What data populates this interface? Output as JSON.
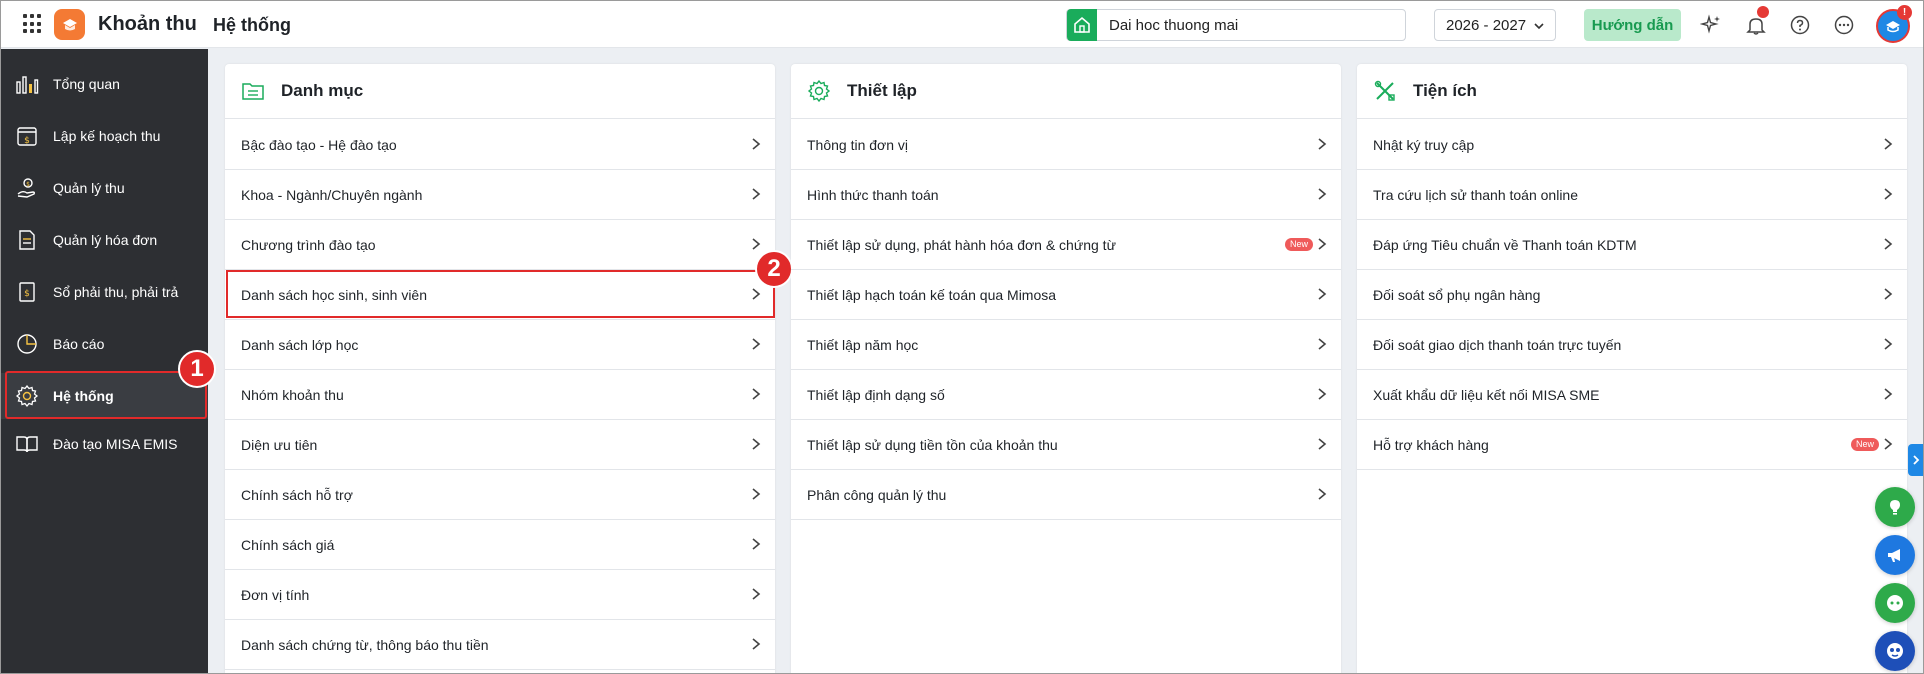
{
  "app": {
    "title": "Khoản thu",
    "page_title": "Hệ thống"
  },
  "topbar": {
    "unit_name": "Dai hoc thuong mai",
    "school_year": "2026 - 2027",
    "guide_label": "Hướng dẫn",
    "icons": [
      "apps-grid-icon",
      "sparkle-ai-icon",
      "bell-icon",
      "help-icon",
      "more-icon"
    ],
    "avatar_badge": "!"
  },
  "sidebar": {
    "items": [
      {
        "label": "Tổng quan",
        "icon": "bar-chart-icon"
      },
      {
        "label": "Lập kế hoạch thu",
        "icon": "calendar-money-icon"
      },
      {
        "label": "Quản lý thu",
        "icon": "hand-money-icon"
      },
      {
        "label": "Quản lý hóa đơn",
        "icon": "invoice-icon"
      },
      {
        "label": "Sổ phải thu, phải trả",
        "icon": "ledger-book-icon"
      },
      {
        "label": "Báo cáo",
        "icon": "pie-chart-icon"
      },
      {
        "label": "Hệ thống",
        "icon": "gear-icon",
        "active": true
      },
      {
        "label": "Đào tạo MISA EMIS",
        "icon": "open-book-icon"
      }
    ]
  },
  "panels": {
    "danh_muc": {
      "title": "Danh mục",
      "items": [
        "Bậc đào tạo - Hệ đào tạo",
        "Khoa - Ngành/Chuyên ngành",
        "Chương trình đào tạo",
        "Danh sách học sinh, sinh viên",
        "Danh sách lớp học",
        "Nhóm khoản thu",
        "Diện ưu tiên",
        "Chính sách hỗ trợ",
        "Chính sách giá",
        "Đơn vị tính",
        "Danh sách chứng từ, thông báo thu tiền"
      ]
    },
    "thiet_lap": {
      "title": "Thiết lập",
      "items": [
        "Thông tin đơn vị",
        "Hình thức thanh toán",
        "Thiết lập sử dụng, phát hành hóa đơn & chứng từ",
        "Thiết lập hạch toán kế toán qua Mimosa",
        "Thiết lập năm học",
        "Thiết lập định dạng số",
        "Thiết lập sử dụng tiền tồn của khoản thu",
        "Phân công quản lý thu"
      ],
      "new_badge": "New"
    },
    "tien_ich": {
      "title": "Tiện ích",
      "items": [
        "Nhật ký truy cập",
        "Tra cứu lịch sử thanh toán online",
        "Đáp ứng Tiêu chuẩn về Thanh toán KDTM",
        "Đối soát sổ phụ ngân hàng",
        "Đối soát giao dịch thanh toán trực tuyến",
        "Xuất khẩu dữ liệu kết nối MISA SME",
        "Hỗ trợ khách hàng"
      ],
      "new_badge": "New"
    }
  },
  "markers": {
    "m1": "1",
    "m2": "2"
  },
  "colors": {
    "accent_green": "#1aac5b",
    "sidebar_bg": "#2d2f33",
    "highlight_red": "#e12a2a",
    "brand_orange": "#f47a34"
  }
}
